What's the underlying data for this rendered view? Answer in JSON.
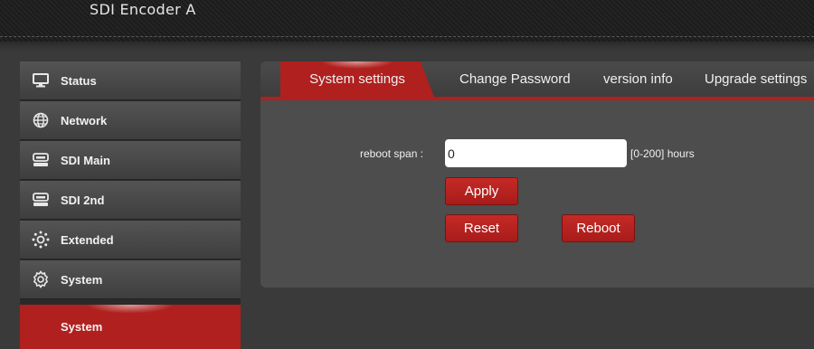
{
  "header": {
    "title": "SDI Encoder  A"
  },
  "sidebar": {
    "items": [
      {
        "label": "Status",
        "icon": "monitor-icon"
      },
      {
        "label": "Network",
        "icon": "globe-icon"
      },
      {
        "label": "SDI Main",
        "icon": "drive-icon"
      },
      {
        "label": "SDI 2nd",
        "icon": "drive-icon"
      },
      {
        "label": "Extended",
        "icon": "gear-dots-icon"
      },
      {
        "label": "System",
        "icon": "gear-icon"
      }
    ],
    "active": {
      "label": "System"
    }
  },
  "tabs": [
    {
      "label": "System settings",
      "active": true
    },
    {
      "label": "Change Password"
    },
    {
      "label": "version info"
    },
    {
      "label": "Upgrade settings"
    }
  ],
  "form": {
    "reboot_label": "reboot span :",
    "reboot_value": "0",
    "reboot_hint": "[0-200] hours"
  },
  "buttons": {
    "apply": "Apply",
    "reset": "Reset",
    "reboot": "Reboot"
  },
  "colors": {
    "accent": "#b0201e",
    "background": "#3a3a3a",
    "panel": "#4d4d4d"
  }
}
